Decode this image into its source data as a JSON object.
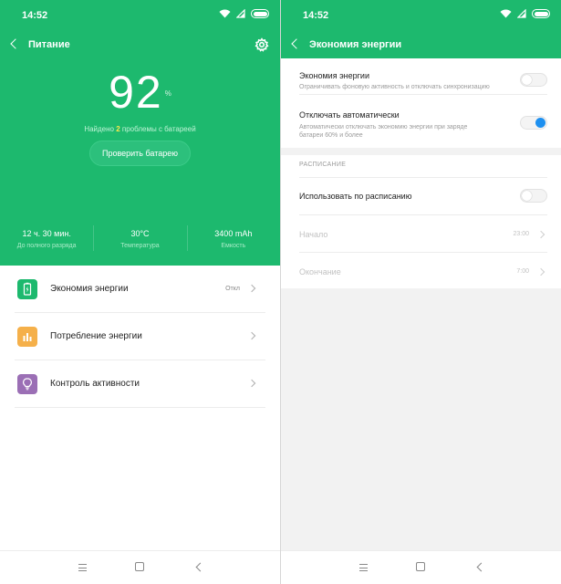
{
  "status_bar": {
    "time": "14:52"
  },
  "left": {
    "title": "Питание",
    "battery_level": "92",
    "battery_unit": "%",
    "found_prefix": "Найдено ",
    "found_count": "2",
    "found_suffix": " проблемы с батареей",
    "check_button": "Проверить батарею",
    "stats": [
      {
        "value": "12 ч. 30 мин.",
        "label": "До полного разряда"
      },
      {
        "value": "30°C",
        "label": "Температура"
      },
      {
        "value": "3400 mAh",
        "label": "Емкость"
      }
    ],
    "menu": [
      {
        "label": "Экономия энергии",
        "value": "Откл",
        "icon": "battery-saver-icon",
        "color": "#1db96e"
      },
      {
        "label": "Потребление энергии",
        "value": "",
        "icon": "bar-chart-icon",
        "color": "#f5b04a"
      },
      {
        "label": "Контроль активности",
        "value": "",
        "icon": "lightbulb-icon",
        "color": "#9b6fb5"
      }
    ]
  },
  "right": {
    "title": "Экономия энергии",
    "power_saving": {
      "label": "Экономия энергии",
      "desc": "Ограничивать фоновую активность и отключать синхронизацию",
      "enabled": false
    },
    "auto_off": {
      "label": "Отключать автоматически",
      "desc_line1": "Автоматически отключать экономию энергии при заряде",
      "desc_line2": "батареи 60% и более",
      "enabled": true
    },
    "schedule_header": "РАСПИСАНИЕ",
    "use_schedule": {
      "label": "Использовать по расписанию",
      "enabled": false
    },
    "start": {
      "label": "Начало",
      "value": "23:00"
    },
    "end": {
      "label": "Окончание",
      "value": "7:00"
    }
  },
  "colors": {
    "primary_green": "#1db96e",
    "toggle_on": "#1e90f0"
  }
}
